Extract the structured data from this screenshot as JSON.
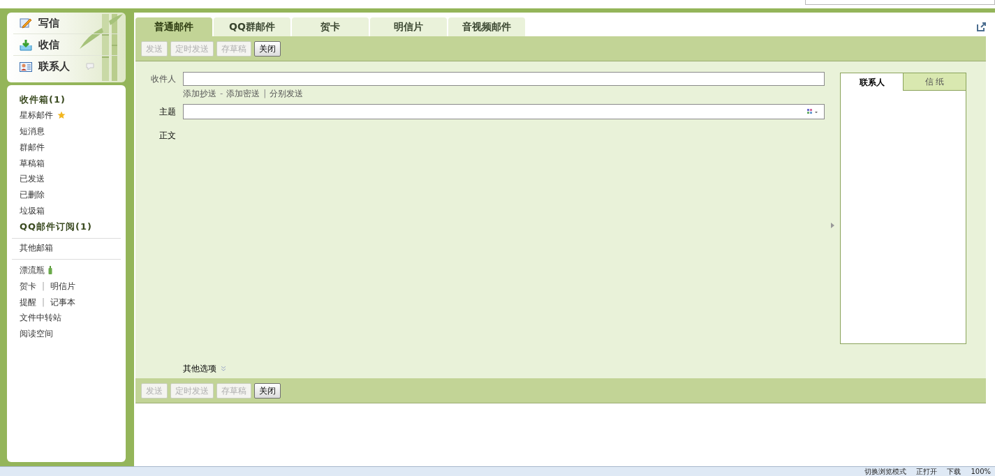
{
  "nav": [
    {
      "label": "写信",
      "kind": "compose"
    },
    {
      "label": "收信",
      "kind": "inbox"
    },
    {
      "label": "联系人",
      "kind": "contacts"
    }
  ],
  "folders": [
    {
      "label": "收件箱(1)",
      "unread": true,
      "kind": "plain"
    },
    {
      "label": "星标邮件",
      "unread": false,
      "kind": "star"
    },
    {
      "label": "短消息",
      "unread": false,
      "kind": "plain"
    },
    {
      "label": "群邮件",
      "unread": false,
      "kind": "plain"
    },
    {
      "label": "草稿箱",
      "unread": false,
      "kind": "plain"
    },
    {
      "label": "已发送",
      "unread": false,
      "kind": "plain"
    },
    {
      "label": "已删除",
      "unread": false,
      "kind": "plain"
    },
    {
      "label": "垃圾箱",
      "unread": false,
      "kind": "plain"
    },
    {
      "label": "QQ邮件订阅(1)",
      "unread": true,
      "kind": "plain"
    }
  ],
  "other_mailbox": "其他邮箱",
  "apps": [
    {
      "links": [
        "漂流瓶"
      ],
      "kind": "bottle"
    },
    {
      "links": [
        "贺卡",
        "明信片"
      ],
      "kind": "pair"
    },
    {
      "links": [
        "提醒",
        "记事本"
      ],
      "kind": "pair"
    },
    {
      "links": [
        "文件中转站"
      ],
      "kind": "plain"
    },
    {
      "links": [
        "阅读空间"
      ],
      "kind": "plain"
    }
  ],
  "app_separator": "|",
  "tabs": [
    {
      "label": "普通邮件",
      "selected": true
    },
    {
      "label": "QQ群邮件",
      "selected": false
    },
    {
      "label": "贺卡",
      "selected": false
    },
    {
      "label": "明信片",
      "selected": false
    },
    {
      "label": "音视频邮件",
      "selected": false
    }
  ],
  "toolbar": [
    {
      "label": "发送",
      "disabled": true
    },
    {
      "label": "定时发送",
      "disabled": true
    },
    {
      "label": "存草稿",
      "disabled": true
    },
    {
      "label": "关闭",
      "disabled": false
    }
  ],
  "form": {
    "recipient_label": "收件人",
    "recipient_links": [
      {
        "label": "添加抄送",
        "sep": "-"
      },
      {
        "label": "添加密送",
        "sep": "|"
      },
      {
        "label": "分别发送"
      }
    ],
    "subject_label": "主题",
    "body_label": "正文",
    "more_options": "其他选项"
  },
  "side_panel": {
    "tabs": [
      {
        "label": "联系人",
        "selected": true
      },
      {
        "label": "信 纸",
        "selected": false
      }
    ]
  },
  "bottom_toolbar": [
    {
      "label": "发送",
      "disabled": true
    },
    {
      "label": "定时发送",
      "disabled": true
    },
    {
      "label": "存草稿",
      "disabled": true
    },
    {
      "label": "关闭",
      "disabled": false
    }
  ],
  "status_bar": {
    "items": [
      "切换浏览模式",
      "正打开",
      "下载",
      "100%"
    ]
  }
}
